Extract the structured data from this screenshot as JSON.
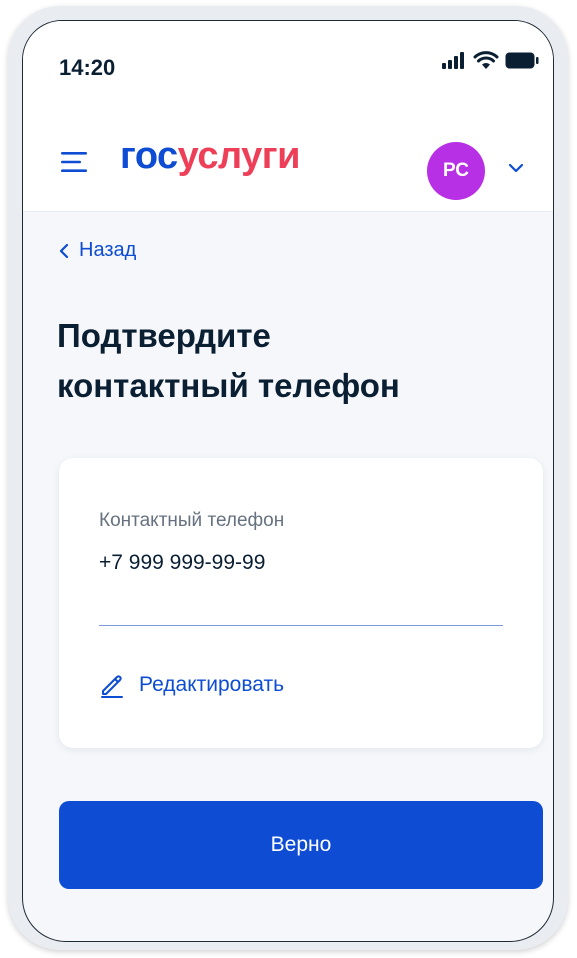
{
  "status_bar": {
    "time": "14:20",
    "icons": [
      "signal-icon",
      "wifi-icon",
      "battery-icon"
    ]
  },
  "header": {
    "logo_part1": "гос",
    "logo_part2": "услуги",
    "avatar_initials": "РС",
    "colors": {
      "logo_blue": "#0d4cd3",
      "logo_red": "#ee3f58",
      "avatar_bg": "#b730e6"
    }
  },
  "back": {
    "label": "Назад"
  },
  "page": {
    "title_line1": "Подтвердите",
    "title_line2": "контактный телефон"
  },
  "phone_card": {
    "label": "Контактный телефон",
    "value": "+7 999 999-99-99",
    "edit_label": "Редактировать"
  },
  "actions": {
    "confirm_label": "Верно",
    "accent": "#0d4cd3"
  }
}
